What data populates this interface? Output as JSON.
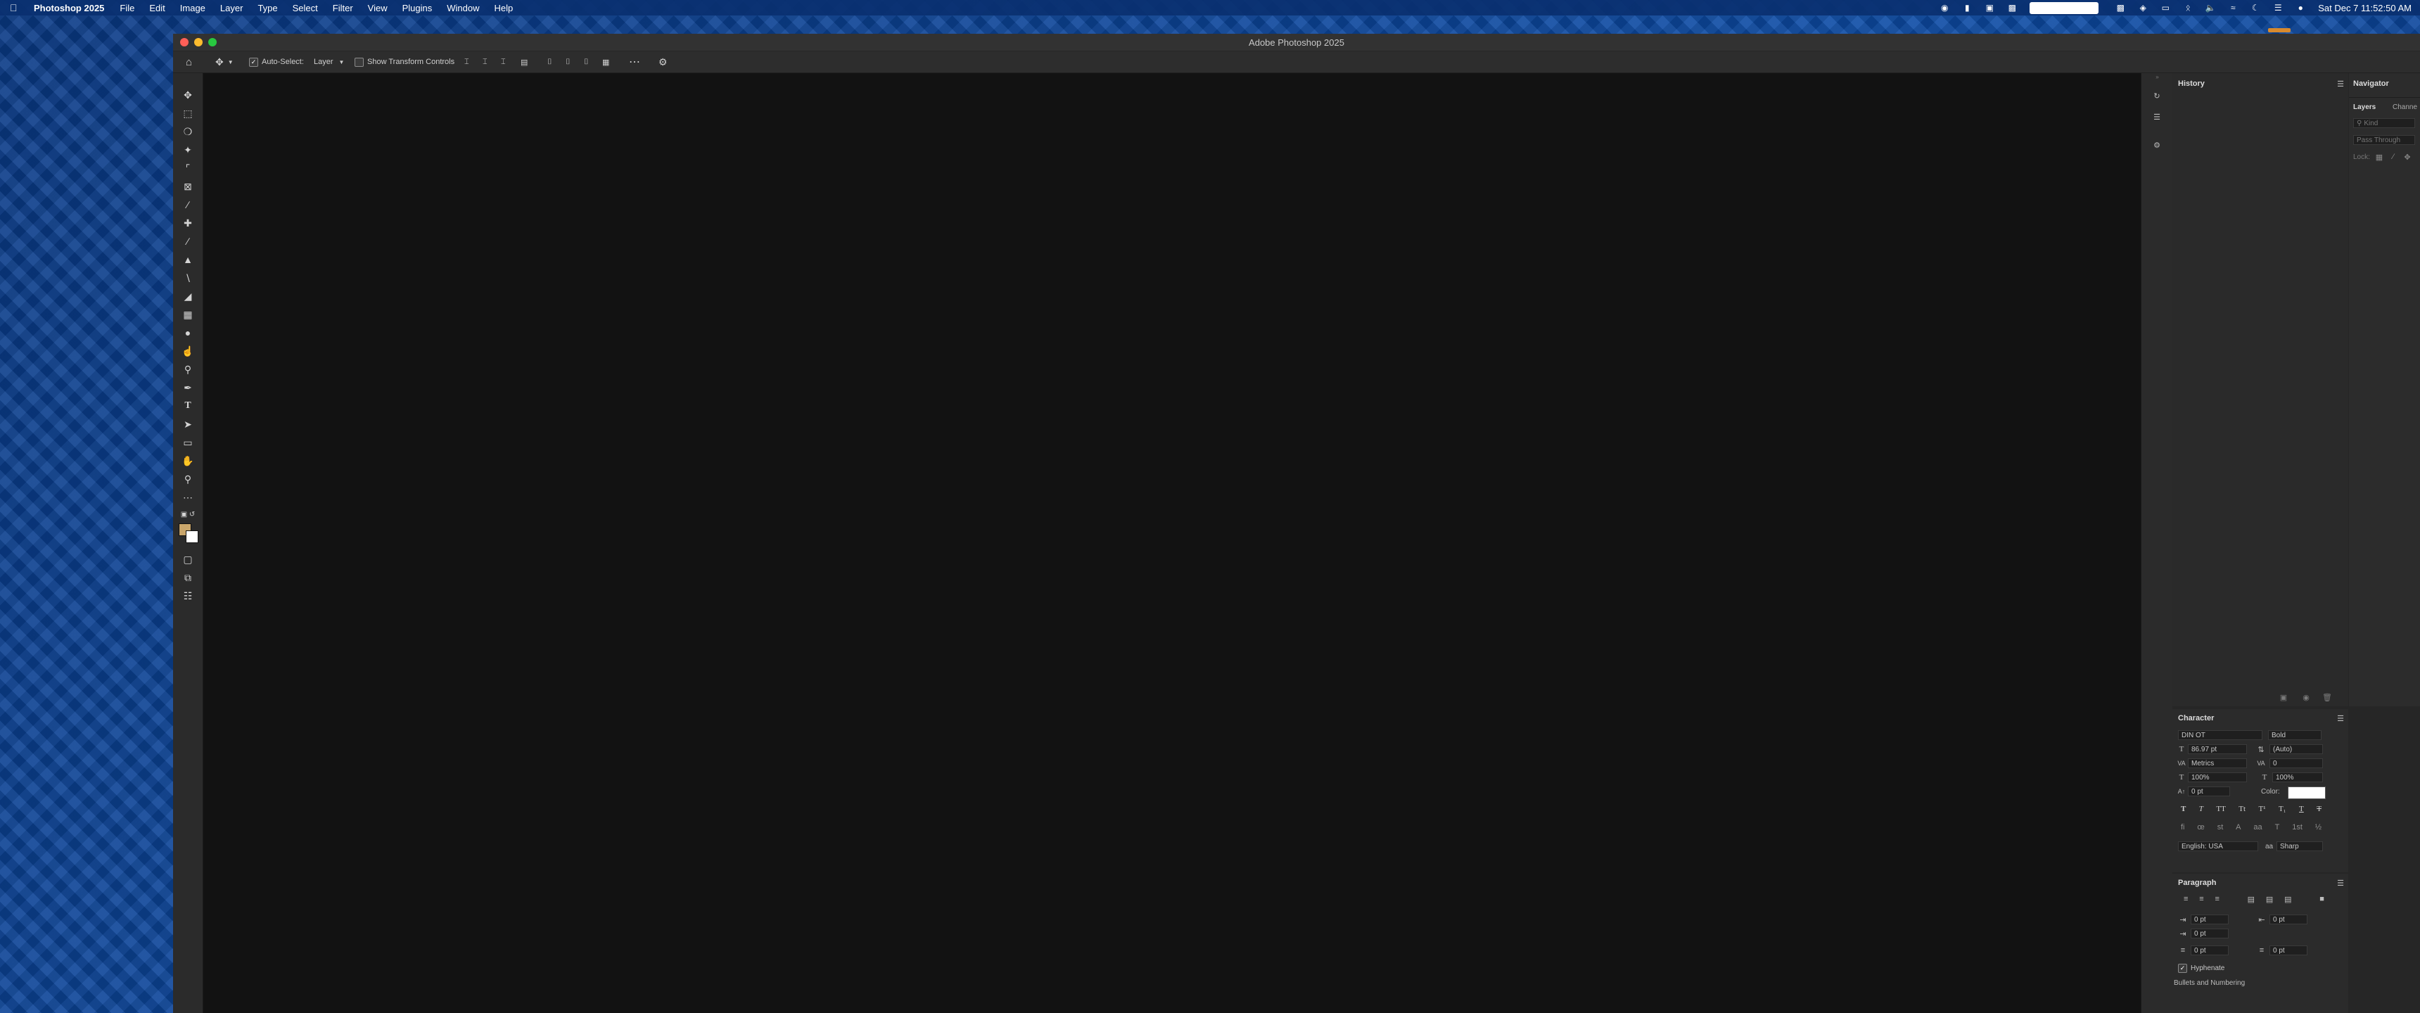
{
  "menubar": {
    "app_name": "Photoshop 2025",
    "items": [
      "File",
      "Edit",
      "Image",
      "Layer",
      "Type",
      "Select",
      "Filter",
      "View",
      "Plugins",
      "Window",
      "Help"
    ],
    "clock": "Sat Dec 7  11:52:50 AM"
  },
  "window": {
    "title": "Adobe Photoshop 2025"
  },
  "options": {
    "auto_select_label": "Auto-Select:",
    "auto_select_checked": true,
    "layer_select_value": "Layer",
    "show_transform_label": "Show Transform Controls",
    "show_transform_checked": false
  },
  "panels": {
    "history_tab": "History",
    "navigator_tab": "Navigator",
    "layers_tab": "Layers",
    "channels_tab": "Channe",
    "kind_placeholder": "Kind",
    "blend_mode": "Pass Through",
    "lock_label": "Lock:"
  },
  "character": {
    "title": "Character",
    "font_family": "DIN OT",
    "font_style": "Bold",
    "size": "86.97 pt",
    "leading": "(Auto)",
    "kerning": "Metrics",
    "tracking": "0",
    "vscale": "100%",
    "hscale": "100%",
    "baseline": "0 pt",
    "color_label": "Color:",
    "color_value": "#ffffff",
    "language": "English: USA",
    "aa_label": "aa",
    "antialias": "Sharp"
  },
  "paragraph": {
    "title": "Paragraph",
    "indent_left": "0 pt",
    "indent_right": "0 pt",
    "indent_first": "0 pt",
    "space_before": "0 pt",
    "space_after": "0 pt",
    "hyphenate_label": "Hyphenate",
    "hyphenate_checked": true,
    "bullets_label": "Bullets and Numbering"
  },
  "colors": {
    "foreground": "#c9a66b",
    "background": "#ffffff",
    "accent_orange": "#d88a2e"
  }
}
